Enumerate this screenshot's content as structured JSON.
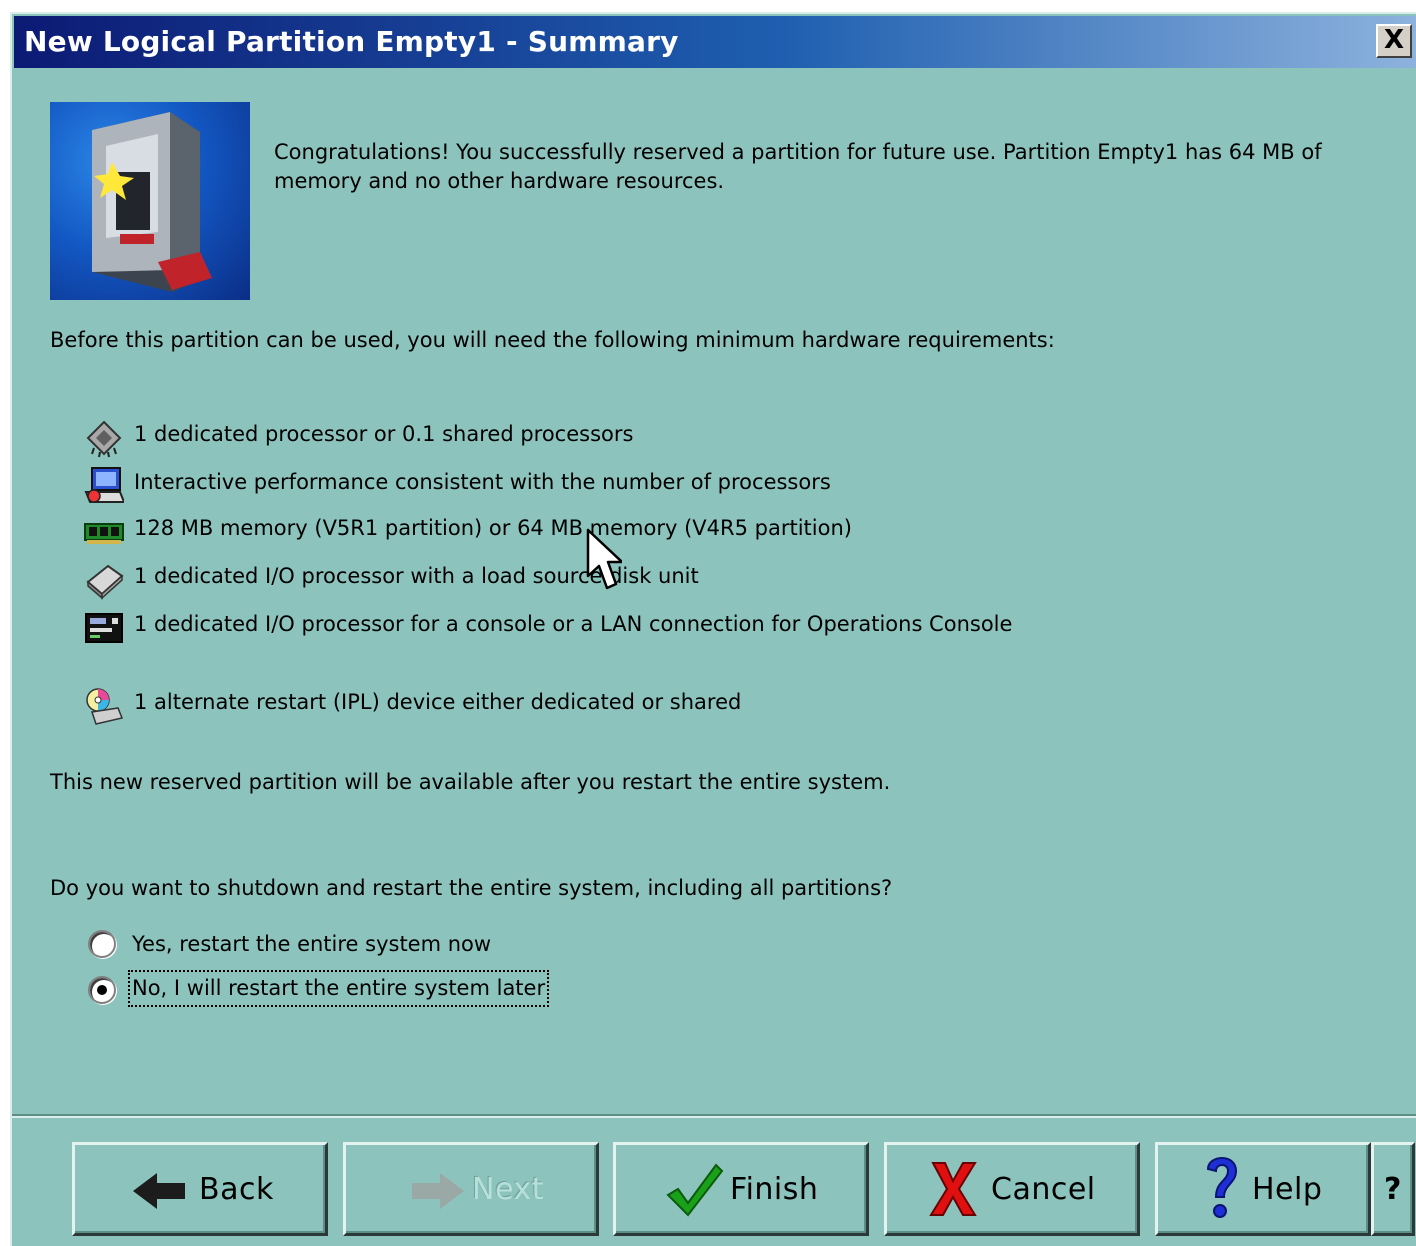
{
  "window": {
    "title": "New Logical Partition Empty1 - Summary",
    "close_label": "X"
  },
  "intro": {
    "text": "Congratulations!  You successfully reserved a partition for future use.  Partition Empty1 has 64 MB of memory and no other hardware resources."
  },
  "requirements": {
    "heading": "Before this partition can be used, you will need the following minimum hardware requirements:",
    "items": [
      {
        "icon": "processor-icon",
        "text": "1 dedicated processor or 0.1 shared processors"
      },
      {
        "icon": "interactive-performance-icon",
        "text": "Interactive performance consistent with the number of processors"
      },
      {
        "icon": "memory-icon",
        "text": "128 MB memory (V5R1 partition) or 64 MB memory (V4R5 partition)"
      },
      {
        "icon": "disk-unit-icon",
        "text": "1 dedicated I/O processor with a load source disk unit"
      },
      {
        "icon": "console-icon",
        "text": "1 dedicated I/O processor for a console or a LAN connection for Operations Console"
      },
      {
        "icon": "restart-device-icon",
        "text": "1 alternate restart (IPL) device either dedicated or shared"
      }
    ]
  },
  "availability_note": "This new reserved partition will be available after you restart the entire system.",
  "restart_question": {
    "label": "Do you want to shutdown and restart the entire system, including all partitions?",
    "options": [
      {
        "label": "Yes, restart the entire system now",
        "selected": false
      },
      {
        "label": "No, I will restart the entire system later",
        "selected": true
      }
    ]
  },
  "buttons": {
    "back": "Back",
    "next": "Next",
    "finish": "Finish",
    "cancel": "Cancel",
    "help": "Help",
    "whats_this": "?"
  },
  "colors": {
    "dialog_background": "#8cc4bd",
    "title_gradient_start": "#0c1a74",
    "title_gradient_end": "#8db2dd",
    "finish_check": "#1aa11a",
    "cancel_x": "#e01010",
    "help_question": "#1f2fd6"
  }
}
